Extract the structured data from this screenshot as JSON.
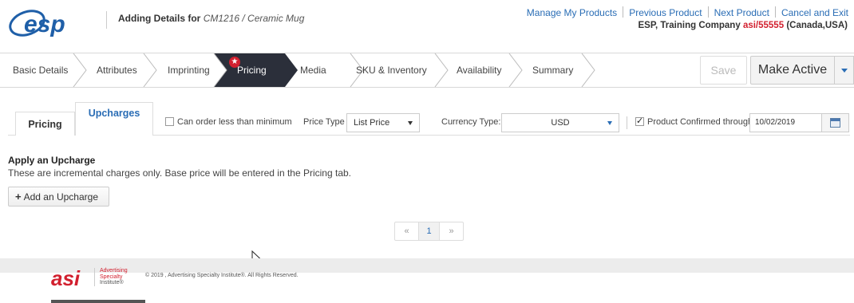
{
  "header": {
    "logo_text": "esp",
    "heading_prefix": "Adding Details for",
    "heading_product": "CM1216 / Ceramic Mug",
    "links": [
      "Manage My Products",
      "Previous Product",
      "Next Product",
      "Cancel and Exit"
    ],
    "company_prefix": "ESP, Training Company",
    "company_asi": "asi/55555",
    "company_suffix": "(Canada,USA)"
  },
  "wizard": {
    "steps": [
      "Basic Details",
      "Attributes",
      "Imprinting",
      "Pricing",
      "Media",
      "SKU & Inventory",
      "Availability",
      "Summary"
    ],
    "active_step": "Pricing",
    "active_color": "#2b2f3a",
    "save_label": "Save",
    "make_active_label": "Make Active"
  },
  "subtabs": {
    "pricing_label": "Pricing",
    "upcharges_label": "Upcharges"
  },
  "options": {
    "can_order_less_label": "Can order less than minimum",
    "can_order_less_checked": false,
    "price_type_label": "Price Type",
    "price_type_value": "List Price",
    "currency_type_label": "Currency Type:",
    "currency_type_value": "USD",
    "product_confirmed_label": "Product Confirmed through",
    "product_confirmed_checked": true,
    "confirmed_date": "10/02/2019"
  },
  "content": {
    "section_title": "Apply an Upcharge",
    "section_desc": "These are incremental charges only. Base price will be entered in the Pricing tab.",
    "add_button_label": "Add an Upcharge"
  },
  "pager": {
    "prev": "«",
    "current": "1",
    "next": "»"
  },
  "footer": {
    "asi_line1": "Advertising",
    "asi_line2": "Specialty",
    "asi_line3": "Institute®",
    "copyright": "© 2019 , Advertising Specialty Institute®. All Rights Reserved."
  },
  "colors": {
    "link_blue": "#2a6db5",
    "brand_red": "#d2202f",
    "logo_blue": "#1f5fa8"
  }
}
